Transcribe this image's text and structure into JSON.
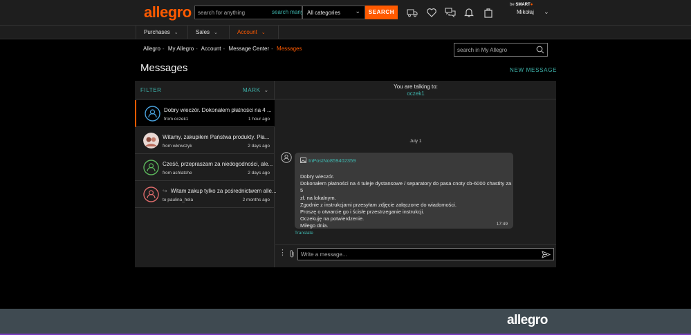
{
  "header": {
    "logo": "allegro",
    "search_placeholder": "search for anything",
    "search_many": "search many",
    "category": "All categories",
    "search_button": "SEARCH",
    "smart_prefix": "be",
    "smart_label": "SMART",
    "user_name": "Mikołaj"
  },
  "nav": {
    "items": [
      {
        "label": "Purchases"
      },
      {
        "label": "Sales"
      },
      {
        "label": "Account"
      }
    ]
  },
  "breadcrumb": [
    "Allegro",
    "My Allegro",
    "Account",
    "Message Center",
    "Messages"
  ],
  "breadcrumb_sep": "-",
  "search_my_allegro_placeholder": "search in My Allegro",
  "page_title": "Messages",
  "new_message": "NEW MESSAGE",
  "filter": {
    "label": "FILTER",
    "mark": "MARK"
  },
  "threads": [
    {
      "snippet": "Dobry wieczór. Dokonałem płatności na 4 ...",
      "from": "from oczek1",
      "time": "1 hour ago",
      "avatar_color": "#4aa3df"
    },
    {
      "snippet": "Witamy, zakupiłem Państwa produkty. Pła...",
      "from": "from wkrwczyk",
      "time": "2 days ago",
      "avatar_color": "#c86b6b"
    },
    {
      "snippet": "Cześć, przepraszam za niedogodności, ale...",
      "from": "from ashlatche",
      "time": "2 days ago",
      "avatar_color": "#5cb85c"
    },
    {
      "snippet": "Witam zakup tylko za pośrednictwem alle...",
      "from": "to paulina_hela",
      "time": "2 months ago",
      "avatar_color": "#e06c6c"
    }
  ],
  "conversation": {
    "talking_to_label": "You are talking to:",
    "talking_to_user": "oczek1",
    "date": "July 1",
    "attachment": "InPostNo859402359",
    "lines": [
      "Dobry wieczór.",
      "Dokonałem płatności na 4 tuleje dystansowe / separatory do pasa cnoty cb-6000 chastity za 5",
      "zł. na lokalnym.",
      "Zgodnie z instrukcjami przesyłam zdjęcie załączone do wiadomości.",
      "Proszę o otwarcie go i ścisłe przestrzeganie instrukcji.",
      "Oczekuję na potwierdzenie.",
      "Miłego dnia."
    ],
    "time": "17:49",
    "translate": "Translate",
    "composer_placeholder": "Write a message..."
  },
  "footer_logo": "allegro",
  "colors": {
    "accent": "#ff5a00",
    "teal": "#3fb6ae"
  }
}
